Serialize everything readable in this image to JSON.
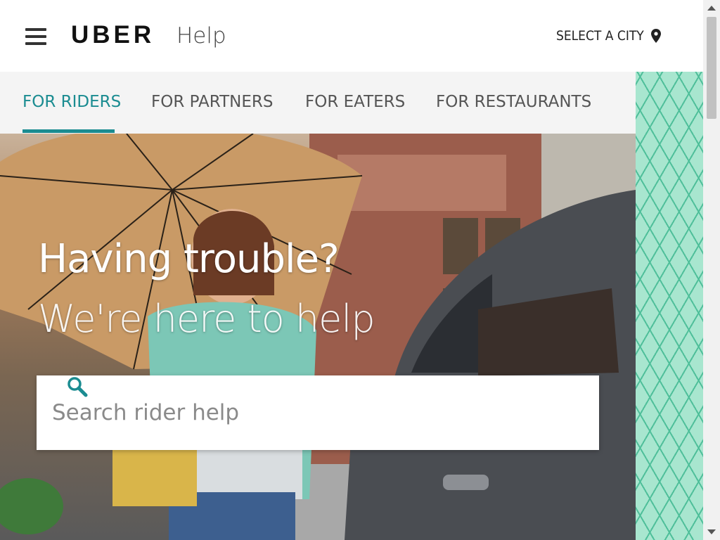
{
  "header": {
    "logo_text": "UBER",
    "logo_suffix": "Help",
    "city_label": "SELECT A CITY",
    "menu_icon": "hamburger-icon",
    "city_icon": "location-pin-icon"
  },
  "tabs": [
    {
      "label": "FOR RIDERS",
      "active": true
    },
    {
      "label": "FOR PARTNERS",
      "active": false
    },
    {
      "label": "FOR EATERS",
      "active": false
    },
    {
      "label": "FOR RESTAURANTS",
      "active": false
    }
  ],
  "hero": {
    "title": "Having trouble?",
    "subtitle": "We're here to help"
  },
  "search": {
    "placeholder": "Search rider help",
    "value": "",
    "icon": "search-icon"
  },
  "colors": {
    "accent": "#1b8c91",
    "pattern_bg": "#a8e6cf",
    "pattern_line": "#4fbf9a"
  }
}
